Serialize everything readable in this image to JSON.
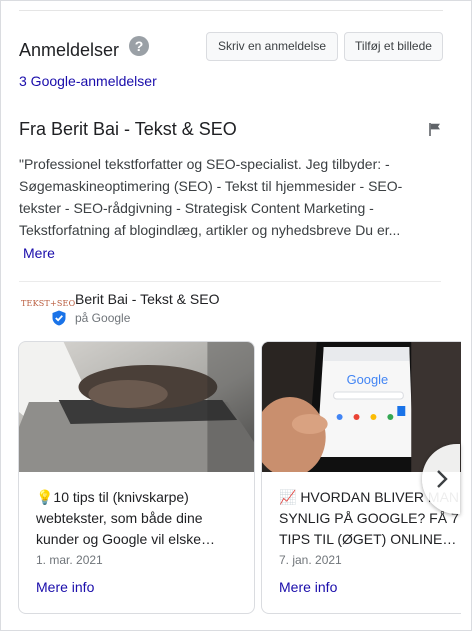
{
  "reviews": {
    "heading": "Anmeldelser",
    "help_icon": "help-icon",
    "write_review_label": "Skriv en anmeldelse",
    "add_photo_label": "Tilføj et billede",
    "count_link": "3 Google-anmeldelser"
  },
  "business": {
    "from_heading": "Fra Berit Bai - Tekst & SEO",
    "description": "\"Professionel tekstforfatter og SEO-specialist. Jeg tilbyder: - Søgemaskineoptimering (SEO) - Tekst til hjemmesider - SEO-tekster - SEO-rådgivning - Strategisk Content Marketing - Tekstforfatning af blogindlæg, artikler og nyhedsbreve Du er...",
    "more_label": "Mere",
    "owner_name": "Berit Bai - Tekst & SEO",
    "owner_source": "på Google",
    "logo_text": "TEKST+SEO"
  },
  "posts": [
    {
      "title": "💡10 tips til (knivskarpe) webtekster, som både dine kunder og Google vil elske…",
      "date": "1. mar. 2021",
      "more_label": "Mere info"
    },
    {
      "title": "📈 HVORDAN BLIVER MAN SYNLIG PÅ GOOGLE? FÅ 7 TIPS TIL (ØGET) ONLINE…",
      "date": "7. jan. 2021",
      "more_label": "Mere info"
    }
  ],
  "colors": {
    "link": "#1a0dab",
    "verified": "#1a73e8"
  }
}
